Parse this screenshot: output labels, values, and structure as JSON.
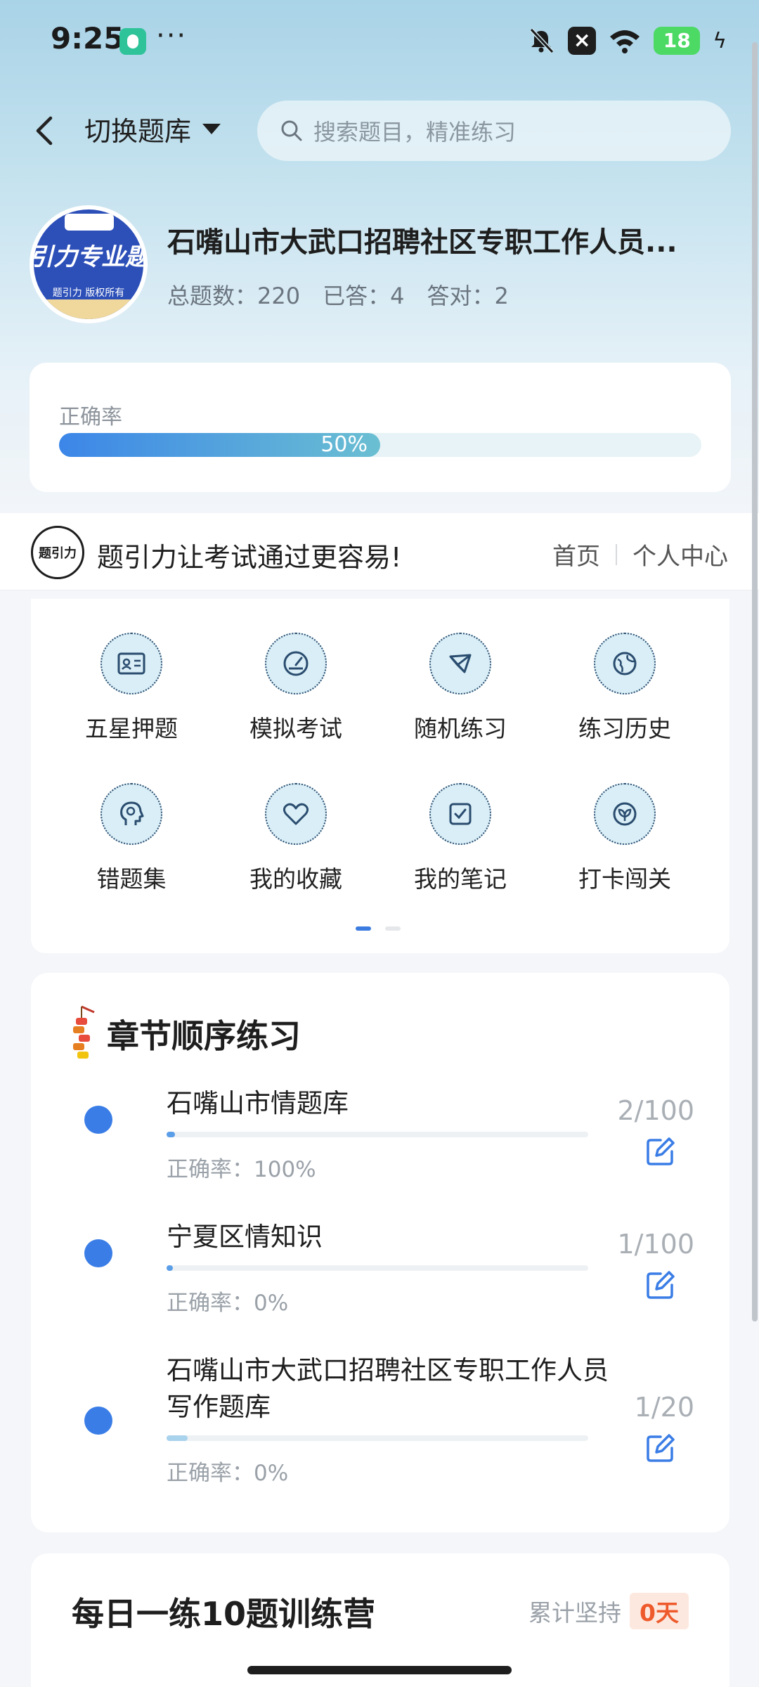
{
  "status": {
    "time": "9:25",
    "dots": "···",
    "battery": "18"
  },
  "header": {
    "switch_label": "切换题库",
    "search_placeholder": "搜索题目，精准练习"
  },
  "bank": {
    "logo_text": "引力专业题",
    "logo_sub": "题引力 版权所有",
    "title": "石嘴山市大武口招聘社区专职工作人员...",
    "stats": {
      "total": "总题数：220",
      "answered": "已答：4",
      "correct": "答对：2"
    }
  },
  "accuracy": {
    "label": "正确率",
    "percent_text": "50%",
    "value": 0.5
  },
  "promo": {
    "logo_text": "题引力",
    "text": "题引力让考试通过更容易!",
    "link_home": "首页",
    "link_profile": "个人中心"
  },
  "features": [
    {
      "label": "五星押题",
      "icon": "id-card-icon"
    },
    {
      "label": "模拟考试",
      "icon": "gauge-icon"
    },
    {
      "label": "随机练习",
      "icon": "network-icon"
    },
    {
      "label": "练习历史",
      "icon": "globe-icon"
    },
    {
      "label": "错题集",
      "icon": "head-icon"
    },
    {
      "label": "我的收藏",
      "icon": "heart-icon"
    },
    {
      "label": "我的笔记",
      "icon": "note-check-icon"
    },
    {
      "label": "打卡闯关",
      "icon": "leaf-icon"
    }
  ],
  "chapters": {
    "title": "章节顺序练习",
    "items": [
      {
        "name": "石嘴山市情题库",
        "accuracy": "正确率：100%",
        "count": "2/100",
        "progress": 0.02
      },
      {
        "name": "宁夏区情知识",
        "accuracy": "正确率：0%",
        "count": "1/100",
        "progress": 0.01
      },
      {
        "name": "石嘴山市大武口招聘社区专职工作人员写作题库",
        "accuracy": "正确率：0%",
        "count": "1/20",
        "progress": 0.05
      }
    ]
  },
  "daily": {
    "title": "每日一练10题训练营",
    "streak_label": "累计坚持",
    "streak_value": "0天"
  },
  "colors": {
    "accent": "#3a7de6",
    "badge": "#ee5a2c"
  }
}
